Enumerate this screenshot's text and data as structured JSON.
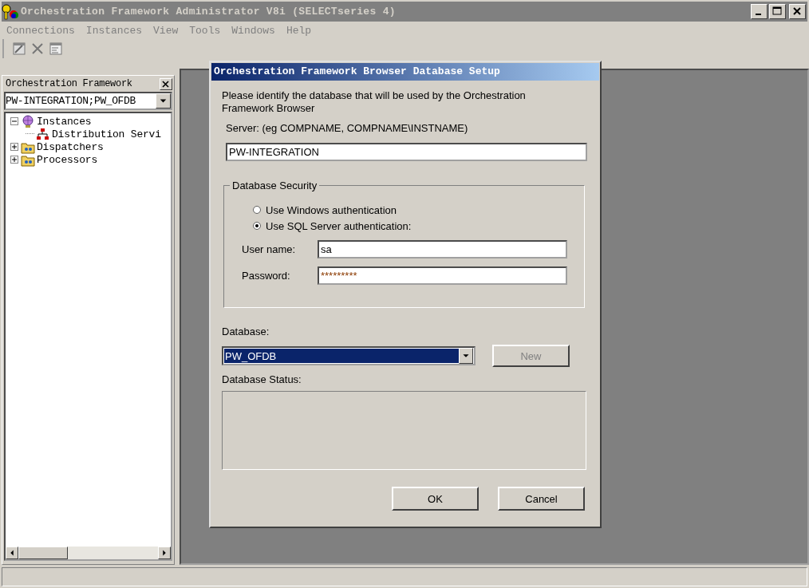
{
  "window": {
    "title": "Orchestration Framework Administrator V8i (SELECTseries 4)",
    "active": false
  },
  "menu": [
    {
      "label": "Connections",
      "disabled": true
    },
    {
      "label": "Instances",
      "disabled": true
    },
    {
      "label": "View",
      "disabled": true
    },
    {
      "label": "Tools",
      "disabled": true
    },
    {
      "label": "Windows",
      "disabled": true
    },
    {
      "label": "Help",
      "disabled": true
    }
  ],
  "toolbar": [
    {
      "kind": "edit"
    },
    {
      "kind": "delete"
    },
    {
      "kind": "properties"
    }
  ],
  "sidebar": {
    "title": "Orchestration Framework",
    "connection": "PW-INTEGRATION;PW_OFDB",
    "tree": [
      {
        "label": "Instances",
        "kind": "globe",
        "expanded": true,
        "children": [
          {
            "label": "Distribution Servi",
            "kind": "network"
          }
        ]
      },
      {
        "label": "Dispatchers",
        "kind": "folder",
        "expanded": false
      },
      {
        "label": "Processors",
        "kind": "folder",
        "expanded": false
      }
    ]
  },
  "dialog": {
    "title": "Orchestration Framework Browser Database Setup",
    "intro": "Please identify the database that will be used by the Orchestration Framework Browser",
    "server_label": "Server:  (eg COMPNAME, COMPNAME\\INSTNAME)",
    "server": "PW-INTEGRATION",
    "security": {
      "title": "Database Security",
      "options": [
        {
          "label": "Use Windows authentication",
          "selected": false
        },
        {
          "label": "Use SQL Server authentication:",
          "selected": true
        }
      ],
      "username_label": "User name:",
      "username": "sa",
      "password_label": "Password:",
      "password": "*********"
    },
    "database_label": "Database:",
    "database": "PW_OFDB",
    "new_button": {
      "label": "New",
      "disabled": true
    },
    "status_label": "Database Status:",
    "buttons": [
      "OK",
      "Cancel"
    ]
  }
}
